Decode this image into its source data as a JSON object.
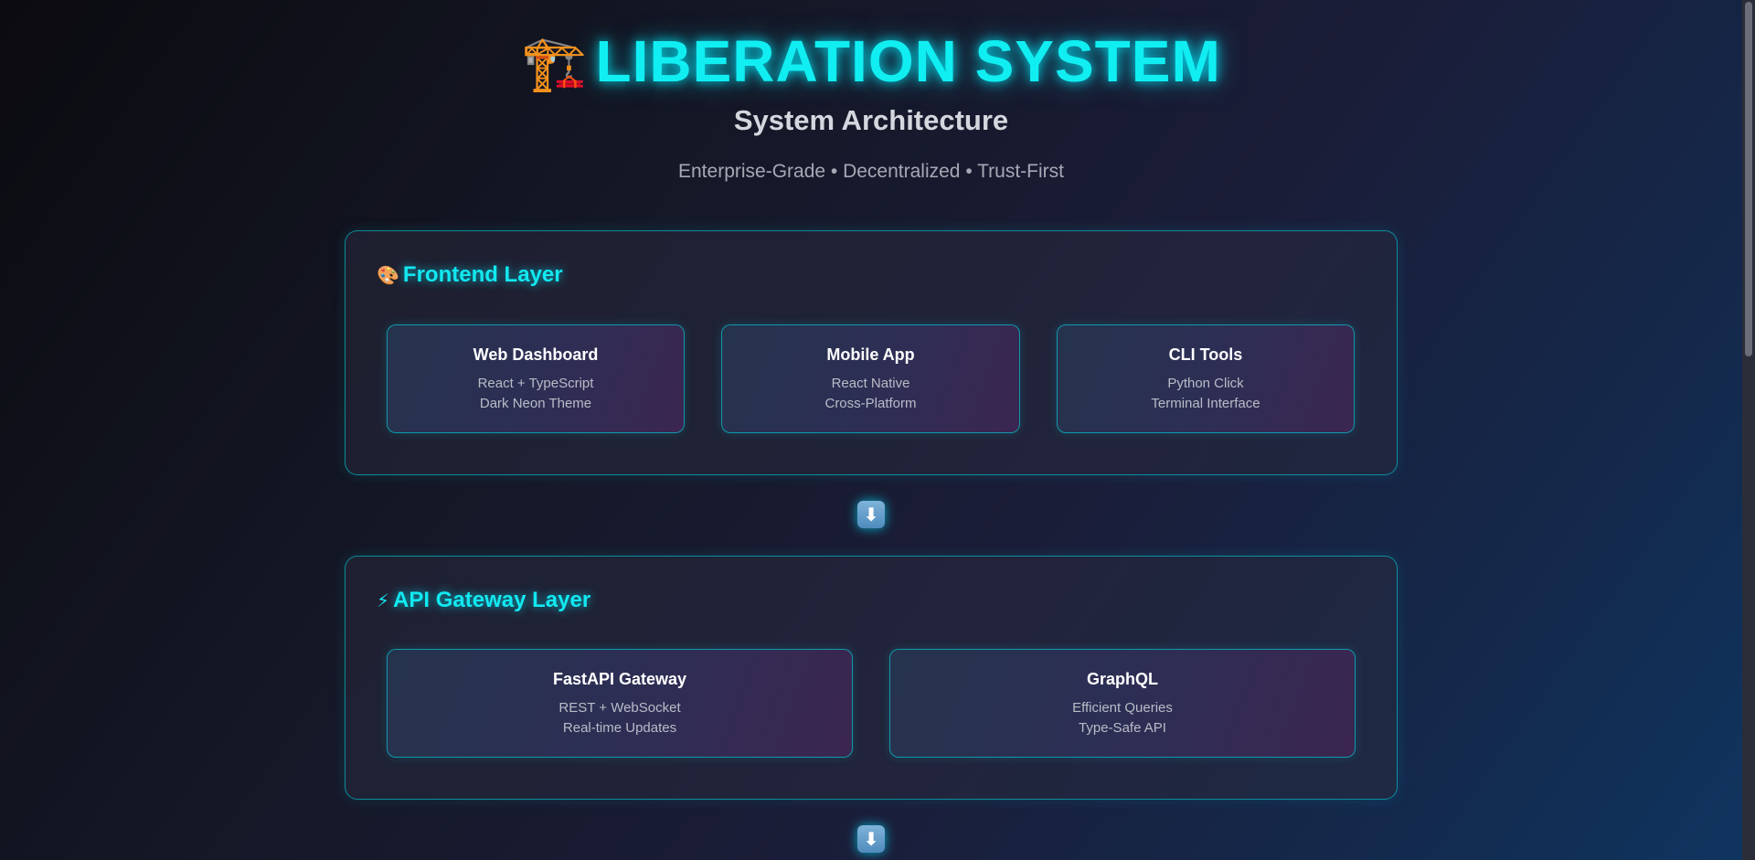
{
  "header": {
    "icon": "🏗️",
    "title": "LIBERATION SYSTEM",
    "subtitle": "System Architecture",
    "tagline": "Enterprise-Grade • Decentralized • Trust-First"
  },
  "layers": [
    {
      "icon": "🎨",
      "title": "Frontend Layer",
      "cards": [
        {
          "title": "Web Dashboard",
          "line1": "React + TypeScript",
          "line2": "Dark Neon Theme"
        },
        {
          "title": "Mobile App",
          "line1": "React Native",
          "line2": "Cross-Platform"
        },
        {
          "title": "CLI Tools",
          "line1": "Python Click",
          "line2": "Terminal Interface"
        }
      ]
    },
    {
      "icon": "⚡",
      "title": "API Gateway Layer",
      "cards": [
        {
          "title": "FastAPI Gateway",
          "line1": "REST + WebSocket",
          "line2": "Real-time Updates"
        },
        {
          "title": "GraphQL",
          "line1": "Efficient Queries",
          "line2": "Type-Safe API"
        }
      ]
    }
  ],
  "arrow_icon": "⬇",
  "colors": {
    "accent": "#11eef2",
    "border": "#00d2dc",
    "background_start": "#0b0b10",
    "background_end": "#0f3560"
  }
}
